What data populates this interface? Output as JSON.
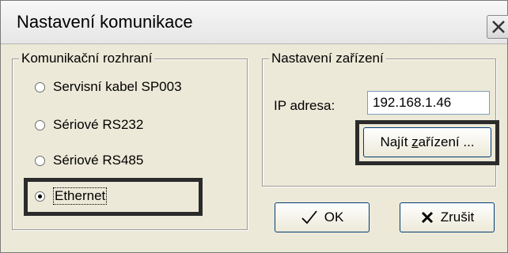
{
  "window": {
    "title": "Nastavení komunikace",
    "close_icon": "close-icon"
  },
  "interface_group": {
    "legend": "Komunikační rozhraní",
    "options": [
      {
        "label": "Servisní kabel SP003",
        "selected": false
      },
      {
        "label": "Sériové RS232",
        "selected": false
      },
      {
        "label": "Sériové RS485",
        "selected": false
      },
      {
        "label": "Ethernet",
        "selected": true
      }
    ]
  },
  "device_group": {
    "legend": "Nastavení zařízení",
    "ip_label": "IP adresa:",
    "ip_value": "192.168.1.46",
    "find_button_prefix": "Najít ",
    "find_button_underlined": "z",
    "find_button_suffix": "ařízení ..."
  },
  "buttons": {
    "ok_label": "OK",
    "ok_icon": "checkmark-icon",
    "cancel_label": "Zrušit",
    "cancel_icon": "x-icon"
  },
  "colors": {
    "dialog_bg": "#ece9d8",
    "highlight_frame": "#2b2b2b"
  }
}
